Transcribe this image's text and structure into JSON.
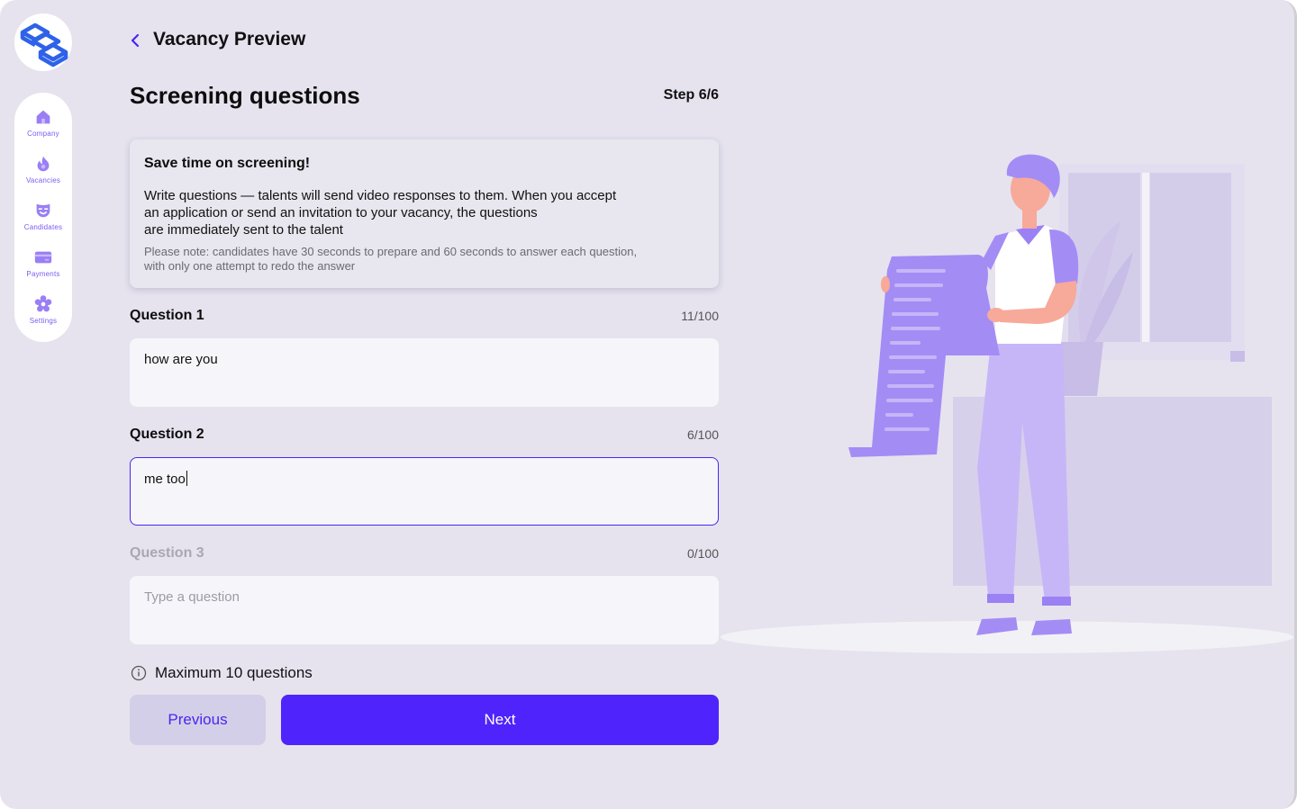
{
  "header": {
    "back_icon": "chevron-left-icon",
    "title": "Vacancy Preview"
  },
  "sidebar": {
    "logo_icon": "cube-stack-logo",
    "items": [
      {
        "label": "Company",
        "icon": "home-icon"
      },
      {
        "label": "Vacancies",
        "icon": "flame-icon"
      },
      {
        "label": "Candidates",
        "icon": "smiley-mask-icon"
      },
      {
        "label": "Payments",
        "icon": "card-icon"
      },
      {
        "label": "Settings",
        "icon": "gear-icon"
      }
    ]
  },
  "page": {
    "title": "Screening questions",
    "step": "Step 6/6"
  },
  "info": {
    "title": "Save time on screening!",
    "body_line1": "Write questions — talents will send video responses to them. When you accept",
    "body_line2": "an application or send an invitation to your vacancy, the questions",
    "body_line3": "are immediately sent to the talent",
    "note_line1": "Please note: candidates have 30 seconds to prepare and 60 seconds to answer each question,",
    "note_line2": "with only one attempt to redo the answer"
  },
  "questions": [
    {
      "label": "Question 1",
      "count": "11/100",
      "value": "how are you",
      "placeholder": ""
    },
    {
      "label": "Question 2",
      "count": "6/100",
      "value": "me too",
      "placeholder": ""
    },
    {
      "label": "Question 3",
      "count": "0/100",
      "value": "",
      "placeholder": "Type a question"
    }
  ],
  "max_note": "Maximum 10 questions",
  "buttons": {
    "previous": "Previous",
    "next": "Next"
  },
  "colors": {
    "accent": "#4f23fb",
    "nav_icon": "#8a6cf4",
    "background": "#e6e3ef",
    "illustration_purple": "#a48cf5"
  }
}
